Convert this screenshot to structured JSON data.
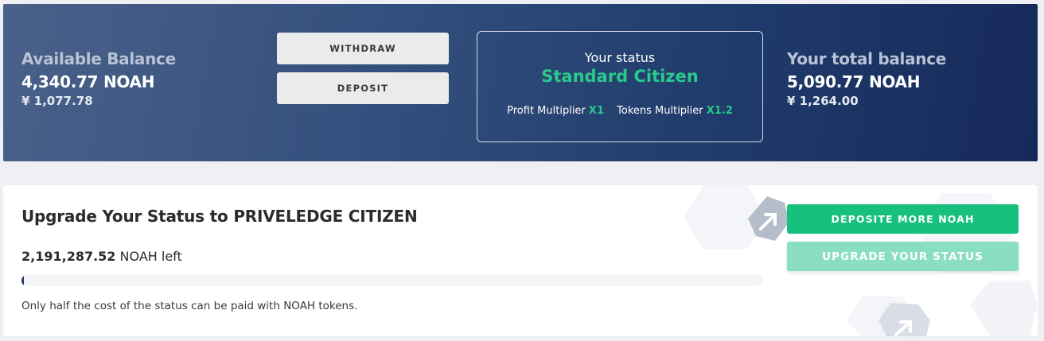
{
  "wallet": {
    "available": {
      "label": "Available Balance",
      "amount": "4,340.77 NOAH",
      "fiat": "¥ 1,077.78"
    },
    "total": {
      "label": "Your total balance",
      "amount": "5,090.77 NOAH",
      "fiat": "¥ 1,264.00"
    },
    "actions": {
      "withdraw_label": "WITHDRAW",
      "deposit_label": "DEPOSIT"
    },
    "status": {
      "heading": "Your status",
      "name": "Standard Citizen",
      "profit_label": "Profit Multiplier",
      "profit_value": "X1",
      "tokens_label": "Tokens Multiplier",
      "tokens_value": "X1.2"
    }
  },
  "upgrade": {
    "title": "Upgrade Your Status to PRIVELEDGE CITIZEN",
    "left_amount": "2,191,287.52",
    "left_suffix": "NOAH left",
    "progress_fraction": 0.002,
    "note": "Only half the cost of the status can be paid with NOAH tokens.",
    "deposit_more_label": "DEPOSITE MORE NOAH",
    "upgrade_label": "UPGRADE YOUR STATUS"
  },
  "colors": {
    "accent_green": "#18c07e",
    "status_green": "#29c98a",
    "hero_dark": "#16295a",
    "progress_fill": "#1e3766"
  },
  "icons": {
    "decorative": "arrow-up-right-hexagon-icon"
  }
}
